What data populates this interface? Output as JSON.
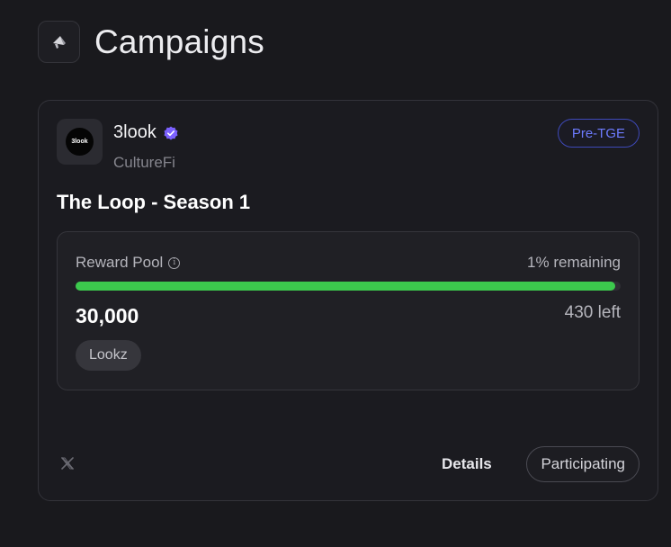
{
  "page": {
    "title": "Campaigns",
    "icon": "megaphone-icon"
  },
  "campaign": {
    "project_name": "3look",
    "logo_text": "3look",
    "verified_icon": "verified-badge-icon",
    "category": "CultureFi",
    "badge": "Pre-TGE",
    "title": "The Loop - Season 1",
    "reward_pool": {
      "label": "Reward Pool",
      "info_icon": "info-icon",
      "remaining_text": "1% remaining",
      "progress_fraction": 0.99,
      "amount": "30,000",
      "left_text": "430 left",
      "token": "Lookz"
    },
    "social_icon": "x-icon",
    "details_label": "Details",
    "participating_label": "Participating"
  },
  "colors": {
    "background": "#19191d",
    "progress": "#3cc94d",
    "badge_accent": "#6d7bff",
    "verified": "#7b61ff"
  }
}
